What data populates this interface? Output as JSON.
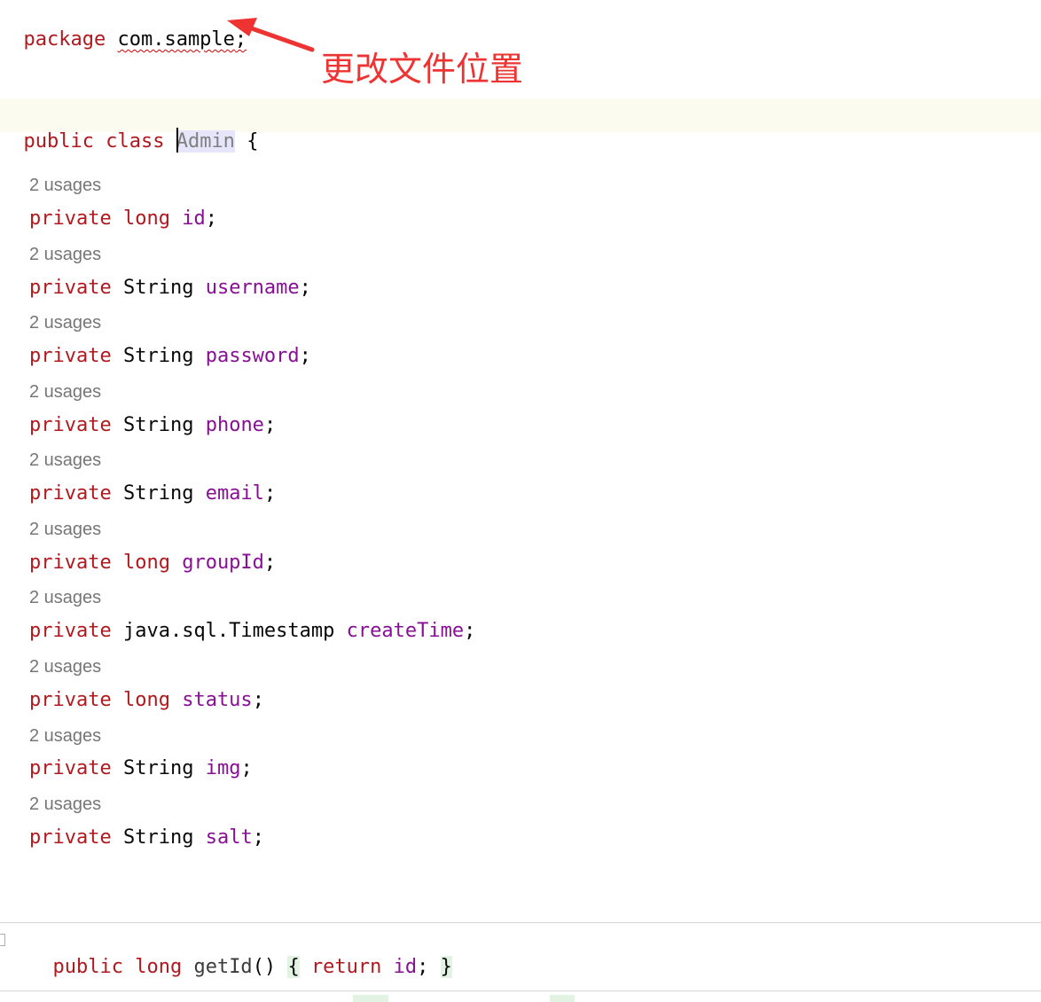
{
  "editor": {
    "package_line": {
      "keyword": "package",
      "name": "com.sample",
      "semicolon": ";"
    },
    "annotation": {
      "text": "更改文件位置",
      "color": "#ee3333"
    },
    "class_line": {
      "modifiers": "public class",
      "class_name": "Admin",
      "brace": "{"
    },
    "fields": [
      {
        "usages": "2 usages",
        "modifier": "private",
        "type": "long",
        "name": "id"
      },
      {
        "usages": "2 usages",
        "modifier": "private",
        "type": "String",
        "name": "username"
      },
      {
        "usages": "2 usages",
        "modifier": "private",
        "type": "String",
        "name": "password"
      },
      {
        "usages": "2 usages",
        "modifier": "private",
        "type": "String",
        "name": "phone"
      },
      {
        "usages": "2 usages",
        "modifier": "private",
        "type": "String",
        "name": "email"
      },
      {
        "usages": "2 usages",
        "modifier": "private",
        "type": "long",
        "name": "groupId"
      },
      {
        "usages": "2 usages",
        "modifier": "private",
        "type": "java.sql.Timestamp",
        "name": "createTime"
      },
      {
        "usages": "2 usages",
        "modifier": "private",
        "type": "long",
        "name": "status"
      },
      {
        "usages": "2 usages",
        "modifier": "private",
        "type": "String",
        "name": "img"
      },
      {
        "usages": "2 usages",
        "modifier": "private",
        "type": "String",
        "name": "salt"
      }
    ],
    "method_line": {
      "modifiers": "public long",
      "name": "getId",
      "parens": "()",
      "open_brace": "{",
      "return_kw": "return",
      "return_value": "id",
      "semicolon": ";",
      "close_brace": "}"
    },
    "colors": {
      "keyword": "#b0191e",
      "field": "#871094",
      "hint": "#767676",
      "class_row_bg": "#fcfbef",
      "class_name_bg": "#e7e5fb"
    }
  }
}
